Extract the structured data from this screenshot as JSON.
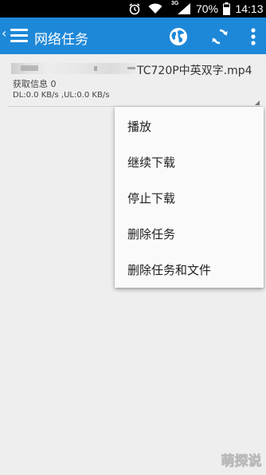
{
  "status_bar": {
    "network_type": "3G",
    "battery_percent": "70%",
    "time": "14:13",
    "icons": [
      "alarm-icon",
      "wifi-icon",
      "signal-icon",
      "battery-icon"
    ]
  },
  "action_bar": {
    "title": "网络任务",
    "background_color": "#1e88d8",
    "icons": [
      "back-chevron-icon",
      "menu-icon",
      "globe-icon",
      "refresh-icon",
      "overflow-icon"
    ]
  },
  "task": {
    "filename_visible": "TC720P中英双字.mp4",
    "info": "获取信息  0",
    "speed": "DL:0.0 KB/s ,UL:0.0 KB/s"
  },
  "popup_menu": {
    "items": [
      {
        "label": "播放"
      },
      {
        "label": "继续下载"
      },
      {
        "label": "停止下载"
      },
      {
        "label": "删除任务"
      },
      {
        "label": "删除任务和文件"
      }
    ]
  },
  "watermark": {
    "text": "萌探说"
  }
}
